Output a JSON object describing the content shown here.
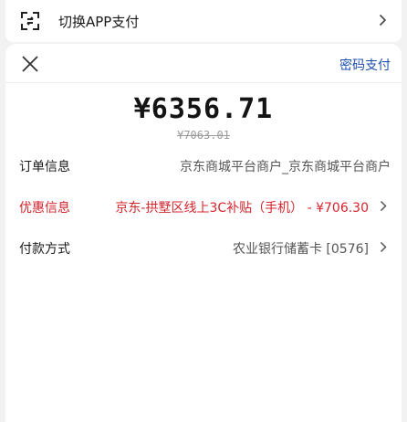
{
  "top_bar": {
    "switch_label": "切换APP支付"
  },
  "header": {
    "password_pay_label": "密码支付"
  },
  "amount": {
    "current": "¥6356.71",
    "original": "¥7063.01"
  },
  "rows": {
    "order": {
      "label": "订单信息",
      "value": "京东商城平台商户_京东商城平台商户"
    },
    "discount": {
      "label": "优惠信息",
      "value": "京东-拱墅区线上3C补贴（手机） - ¥706.30"
    },
    "payment": {
      "label": "付款方式",
      "value": "农业银行储蓄卡 [0576]"
    }
  },
  "colors": {
    "link_blue": "#1f4fae",
    "discount_red": "#d4242c"
  },
  "icons": {
    "switch": "scan-switch-icon",
    "close": "close-icon",
    "chevron": "chevron-right-icon"
  }
}
